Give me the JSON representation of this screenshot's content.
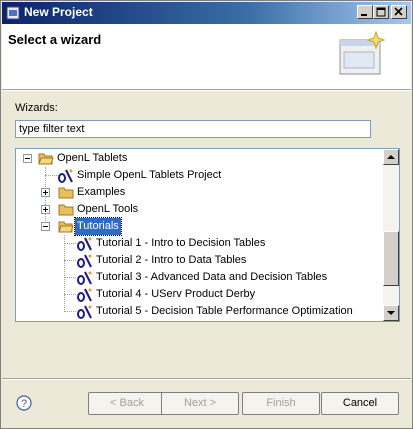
{
  "window": {
    "title": "New Project"
  },
  "banner": {
    "heading": "Select a wizard"
  },
  "wizards": {
    "label": "Wizards:",
    "filter_placeholder": "type filter text",
    "filter_value": "type filter text"
  },
  "tree": {
    "items": [
      {
        "label": "OpenL Tablets",
        "kind": "folder",
        "expanded": true,
        "depth": 0
      },
      {
        "label": "Simple OpenL Tablets Project",
        "kind": "wizard",
        "depth": 1
      },
      {
        "label": "Examples",
        "kind": "folder",
        "expanded": false,
        "depth": 1
      },
      {
        "label": "OpenL Tools",
        "kind": "folder",
        "expanded": false,
        "depth": 1
      },
      {
        "label": "Tutorials",
        "kind": "folder",
        "expanded": true,
        "depth": 1,
        "selected": true
      },
      {
        "label": "Tutorial 1 - Intro to Decision Tables",
        "kind": "wizard",
        "depth": 2
      },
      {
        "label": "Tutorial 2 - Intro to Data Tables",
        "kind": "wizard",
        "depth": 2
      },
      {
        "label": "Tutorial 3 - Advanced Data and Decision Tables",
        "kind": "wizard",
        "depth": 2
      },
      {
        "label": "Tutorial 4 - UServ Product Derby",
        "kind": "wizard",
        "depth": 2
      },
      {
        "label": "Tutorial 5 - Decision Table Performance Optimization",
        "kind": "wizard",
        "depth": 2
      }
    ]
  },
  "buttons": {
    "back": "< Back",
    "next": "Next >",
    "finish": "Finish",
    "cancel": "Cancel"
  },
  "colors": {
    "selection": "#316ac5",
    "folder": "#e8c060",
    "wizard_icon": "#1a1a8c"
  }
}
